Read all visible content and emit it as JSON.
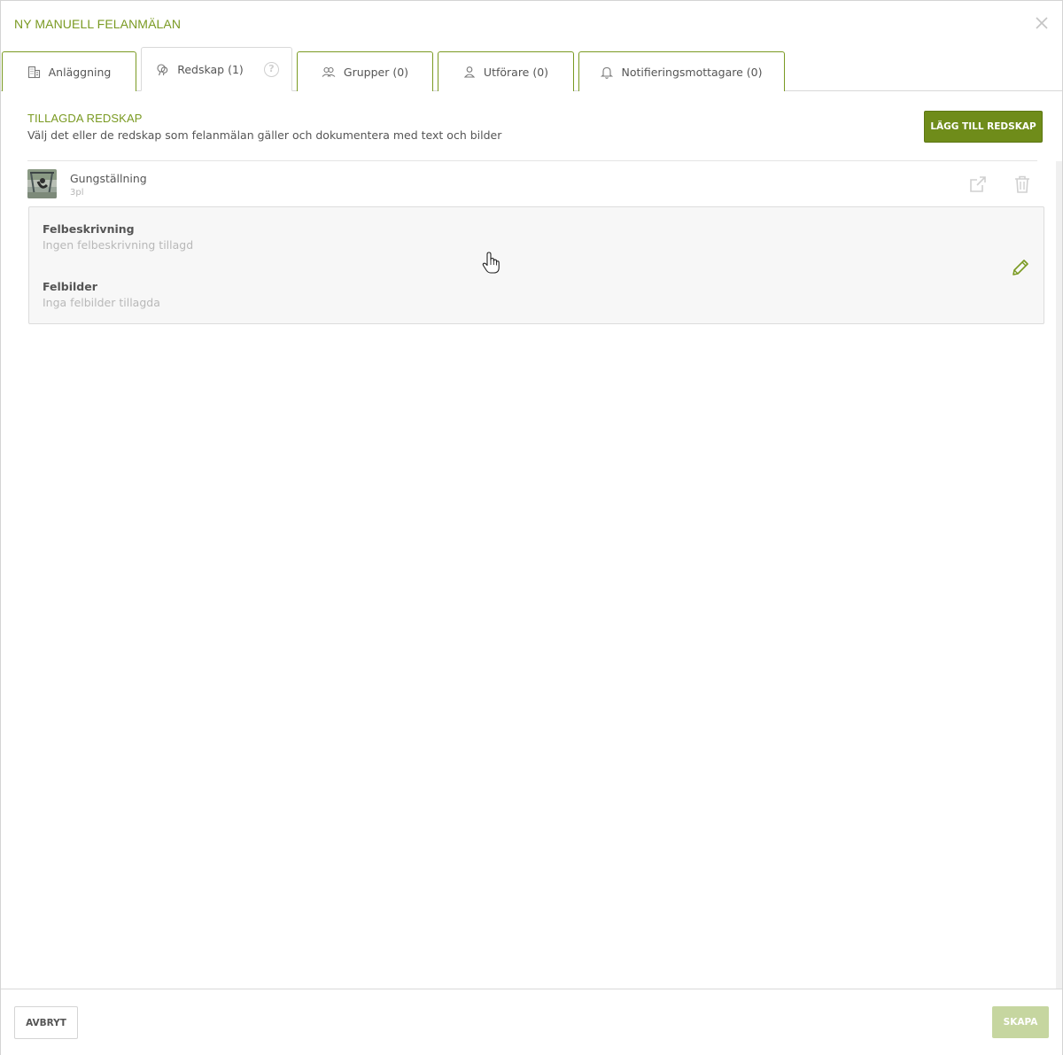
{
  "modal": {
    "title": "NY MANUELL FELANMÄLAN",
    "close_icon": "close-icon"
  },
  "tabs": [
    {
      "label": "Anläggning",
      "icon": "building-icon",
      "active": false
    },
    {
      "label": "Redskap (1)",
      "icon": "equipment-icon",
      "active": true,
      "help": "?"
    },
    {
      "label": "Grupper (0)",
      "icon": "users-icon",
      "active": false
    },
    {
      "label": "Utförare (0)",
      "icon": "user-icon",
      "active": false
    },
    {
      "label": "Notifieringsmottagare (0)",
      "icon": "bell-icon",
      "active": false
    }
  ],
  "section": {
    "title": "TILLAGDA REDSKAP",
    "description": "Välj det eller de redskap som felanmälan gäller och dokumentera med text och bilder",
    "add_button": "LÄGG TILL REDSKAP"
  },
  "equipment": {
    "name": "Gungställning",
    "sub": "3pl",
    "thumbnail_icon": "equipment-photo",
    "actions": [
      "external-link-icon",
      "trash-icon"
    ]
  },
  "details": {
    "description_label": "Felbeskrivning",
    "description_value": "Ingen felbeskrivning tillagd",
    "images_label": "Felbilder",
    "images_value": "Inga felbilder tillagda",
    "edit_icon": "pencil-icon"
  },
  "footer": {
    "cancel_label": "AVBRYT",
    "create_label": "SKAPA",
    "create_disabled": true
  },
  "colors": {
    "accent": "#7a9a22",
    "button_primary": "#6f8c1a",
    "button_disabled": "#c6d6a0"
  }
}
